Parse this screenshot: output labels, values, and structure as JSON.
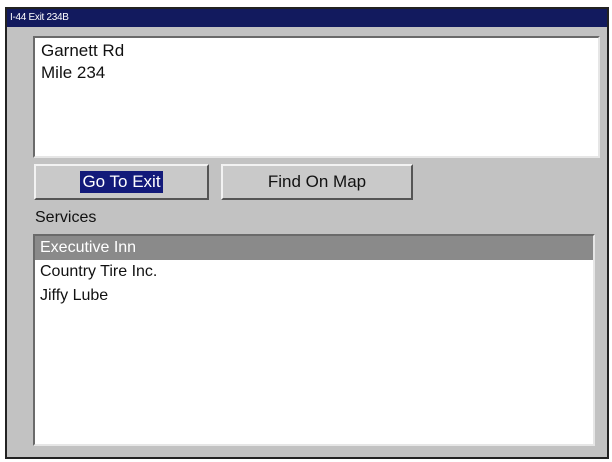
{
  "window": {
    "title": "I-44 Exit 234B"
  },
  "info": {
    "lines": [
      "Garnett Rd",
      "Mile 234"
    ]
  },
  "buttons": {
    "go_to_exit": "Go To Exit",
    "find_on_map": "Find On Map"
  },
  "services": {
    "label": "Services",
    "items": [
      {
        "label": "Executive Inn",
        "selected": true
      },
      {
        "label": "Country Tire Inc.",
        "selected": false
      },
      {
        "label": "Jiffy Lube",
        "selected": false
      }
    ]
  },
  "colors": {
    "title_bar": "#121a5e",
    "selection_highlight": "#8a8a8a",
    "focus_highlight": "#121a7a"
  }
}
